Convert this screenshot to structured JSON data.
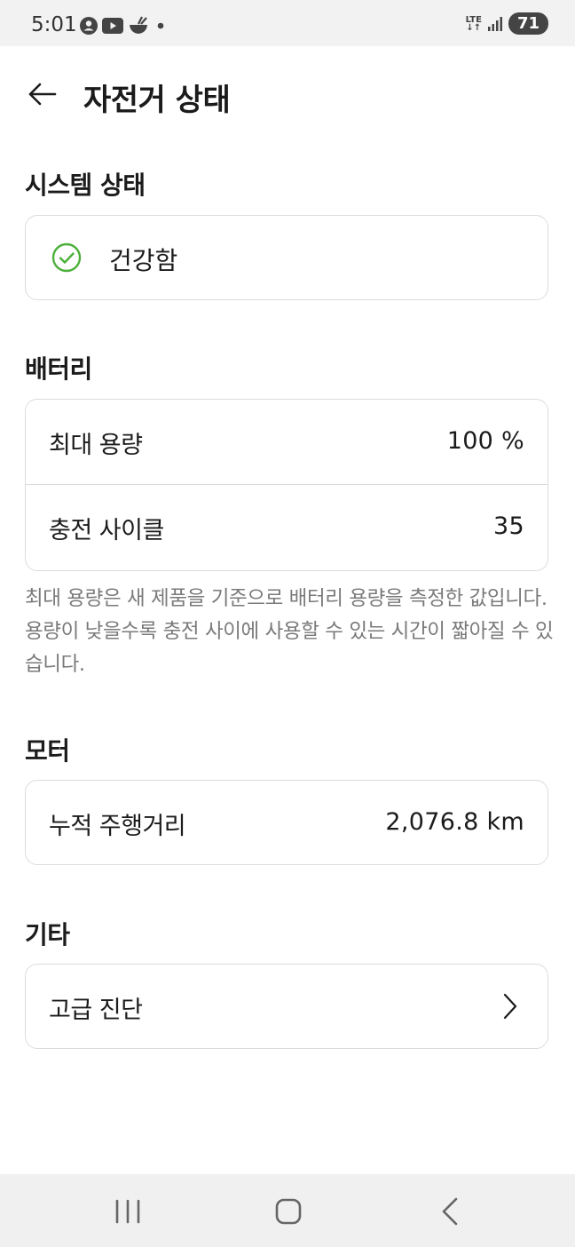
{
  "status_bar": {
    "time": "5:01",
    "network": "LTE",
    "battery": "71",
    "icons": [
      "account-circle-icon",
      "youtube-icon",
      "bowl-icon",
      "dot-icon",
      "signal-icon"
    ]
  },
  "header": {
    "title": "자전거 상태",
    "back_icon": "arrow-left-icon"
  },
  "system": {
    "title": "시스템 상태",
    "status": "건강함",
    "status_icon": "check-circle-icon",
    "status_color": "#4caf3a"
  },
  "battery": {
    "title": "배터리",
    "rows": [
      {
        "label": "최대 용량",
        "value": "100 %"
      },
      {
        "label": "충전 사이클",
        "value": "35"
      }
    ],
    "note": "최대 용량은 새 제품을 기준으로 배터리 용량을 측정한 값입니다. 용량이 낮을수록 충전 사이에 사용할 수 있는 시간이 짧아질 수 있습니다."
  },
  "motor": {
    "title": "모터",
    "rows": [
      {
        "label": "누적 주행거리",
        "value": "2,076.8 km"
      }
    ]
  },
  "other": {
    "title": "기타",
    "rows": [
      {
        "label": "고급 진단",
        "icon": "chevron-right-icon"
      }
    ]
  },
  "nav_bar": {
    "buttons": [
      "recent-apps-icon",
      "home-icon",
      "back-icon"
    ]
  }
}
